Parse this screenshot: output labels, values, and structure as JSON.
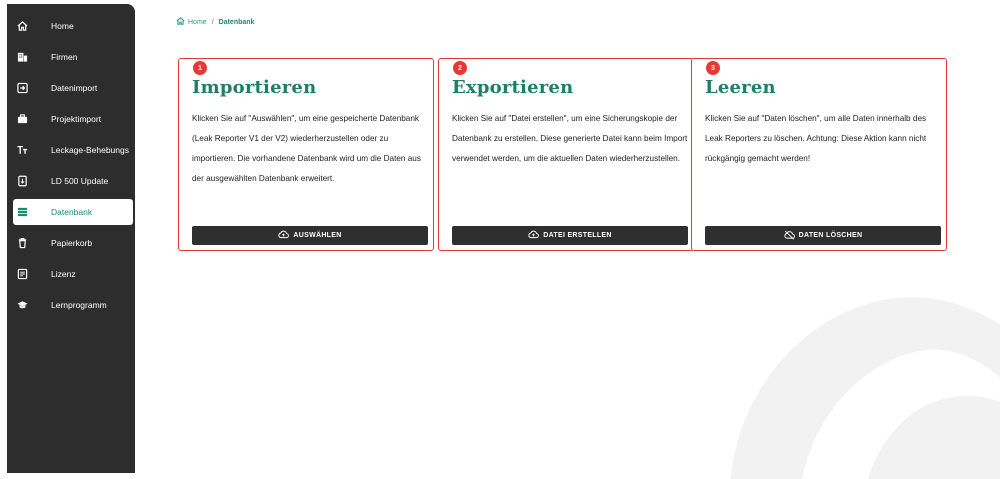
{
  "sidebar": {
    "items": [
      {
        "label": "Home",
        "icon": "home-icon"
      },
      {
        "label": "Firmen",
        "icon": "building-icon"
      },
      {
        "label": "Datenimport",
        "icon": "import-icon"
      },
      {
        "label": "Projektimport",
        "icon": "briefcase-icon"
      },
      {
        "label": "Leckage-Behebungs",
        "icon": "text-icon"
      },
      {
        "label": "LD 500 Update",
        "icon": "device-update-icon"
      },
      {
        "label": "Datenbank",
        "icon": "database-icon",
        "active": true
      },
      {
        "label": "Papierkorb",
        "icon": "trash-icon"
      },
      {
        "label": "Lizenz",
        "icon": "license-icon"
      },
      {
        "label": "Lernprogramm",
        "icon": "graduation-cap-icon"
      }
    ]
  },
  "breadcrumb": {
    "home": "Home",
    "separator": "/",
    "current": "Datenbank"
  },
  "cards": [
    {
      "badge": "1",
      "title": "Importieren",
      "text": "Klicken Sie auf \"Auswählen\", um eine gespeicherte Datenbank (Leak Reporter V1 der V2) wiederherzustellen oder zu importieren. Die vorhandene Datenbank wird um die Daten aus der ausgewählten Datenbank erweitert.",
      "button": "AUSWÄHLEN",
      "button_icon": "cloud-upload-icon"
    },
    {
      "badge": "2",
      "title": "Exportieren",
      "text": "Klicken Sie auf \"Datei erstellen\", um eine Sicherungskopie der Datenbank zu erstellen. Diese generierte Datei kann beim Import verwendet werden, um die aktuellen Daten wiederherzustellen.",
      "button": "DATEI ERSTELLEN",
      "button_icon": "cloud-upload-icon"
    },
    {
      "badge": "3",
      "title": "Leeren",
      "text": "Klicken Sie auf \"Daten löschen\", um alle Daten innerhalb des Leak Reporters zu löschen. Achtung: Diese Aktion kann nicht rückgängig gemacht werden!",
      "button": "DATEN LÖSCHEN",
      "button_icon": "cloud-off-icon"
    }
  ],
  "colors": {
    "sidebar_bg": "#2d2d2d",
    "accent": "#1f7f63",
    "highlight_border": "#e53935",
    "button_bg": "#2f2f2f"
  }
}
